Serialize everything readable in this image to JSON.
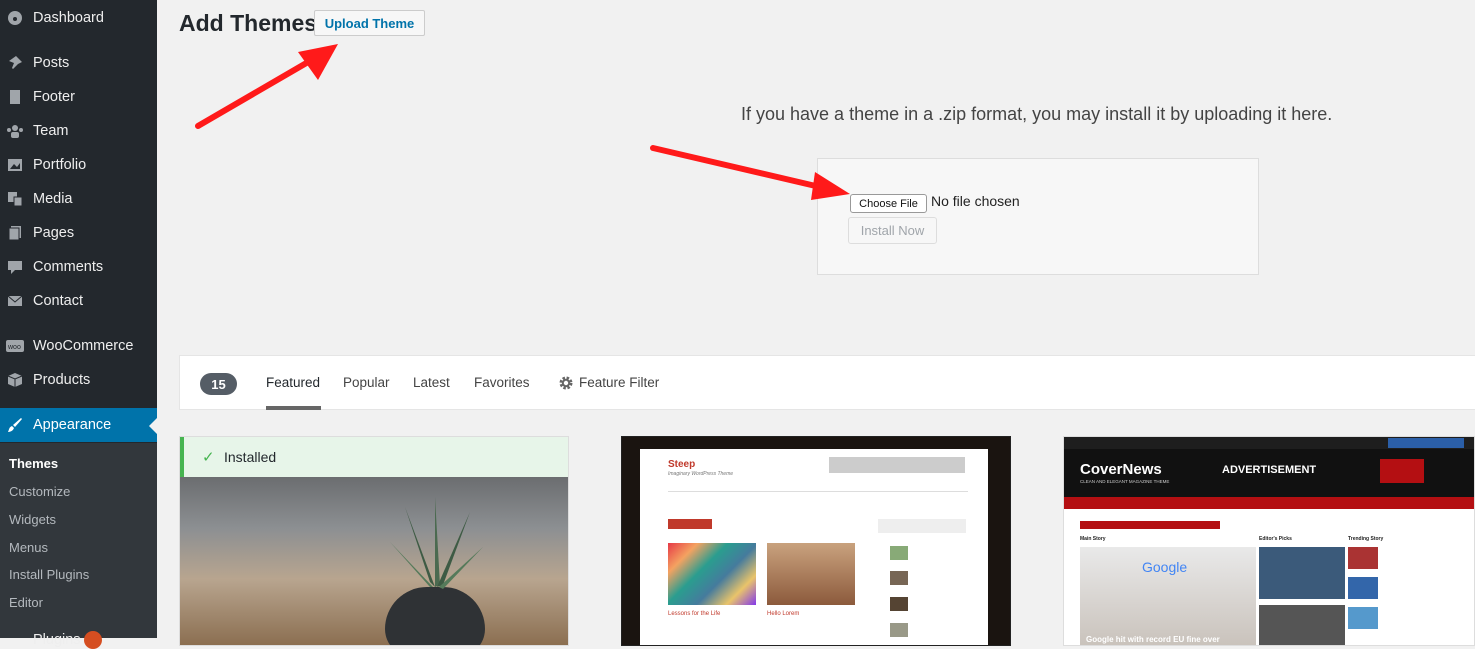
{
  "sidebar": {
    "items": [
      {
        "label": "Dashboard",
        "icon": "dashboard-icon"
      },
      {
        "label": "Posts",
        "icon": "pin-icon"
      },
      {
        "label": "Footer",
        "icon": "page-icon"
      },
      {
        "label": "Team",
        "icon": "team-icon"
      },
      {
        "label": "Portfolio",
        "icon": "portfolio-icon"
      },
      {
        "label": "Media",
        "icon": "media-icon"
      },
      {
        "label": "Pages",
        "icon": "pages-icon"
      },
      {
        "label": "Comments",
        "icon": "comment-icon"
      },
      {
        "label": "Contact",
        "icon": "mail-icon"
      },
      {
        "label": "WooCommerce",
        "icon": "woo-icon"
      },
      {
        "label": "Products",
        "icon": "box-icon"
      },
      {
        "label": "Appearance",
        "icon": "brush-icon"
      }
    ],
    "submenu": [
      "Themes",
      "Customize",
      "Widgets",
      "Menus",
      "Install Plugins",
      "Editor"
    ],
    "plugins_label": "Plugins"
  },
  "header": {
    "title": "Add Themes",
    "upload_button": "Upload Theme"
  },
  "upload": {
    "help_text": "If you have a theme in a .zip format, you may install it by uploading it here.",
    "choose_file": "Choose File",
    "no_file": "No file chosen",
    "install_button": "Install Now"
  },
  "filter": {
    "count": "15",
    "tabs": [
      "Featured",
      "Popular",
      "Latest",
      "Favorites"
    ],
    "feature_filter": "Feature Filter"
  },
  "themes": {
    "installed_label": "Installed",
    "steep_name": "Steep",
    "steep_tagline": "Imaginary WordPress Theme",
    "steep_post1": "Lessons for the Life",
    "steep_post2": "Hello Lorem",
    "covernews_name": "CoverNews",
    "covernews_tagline": "CLEAN AND ELEGANT MAGAZINE THEME",
    "covernews_ad": "ADVERTISEMENT",
    "covernews_main": "Main Story",
    "covernews_picks": "Editor's Picks",
    "covernews_trending": "Trending Story",
    "covernews_headline": "Google hit with record EU fine over"
  },
  "colors": {
    "sidebar_bg": "#23282d",
    "accent": "#0073aa",
    "arrow": "#ff1a1a",
    "installed_green": "#46b450"
  }
}
